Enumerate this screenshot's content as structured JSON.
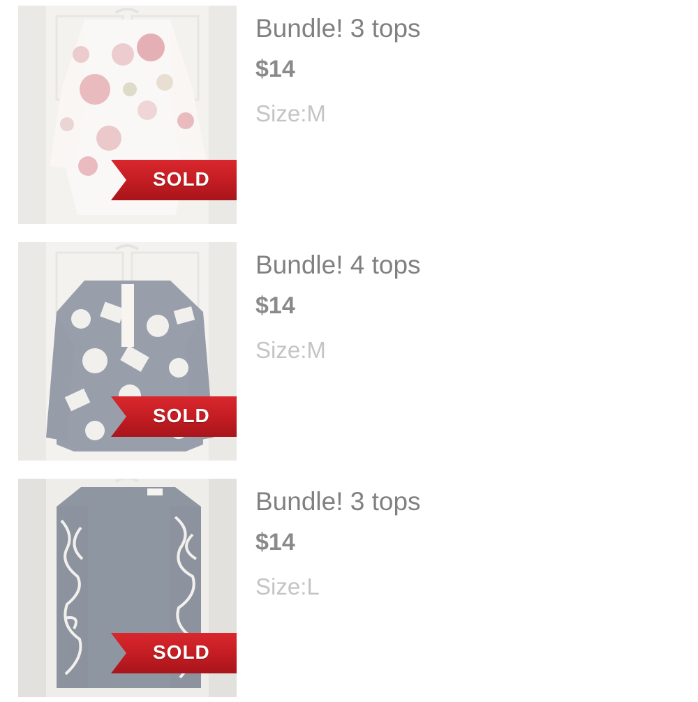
{
  "listings": [
    {
      "title": "Bundle! 3 tops",
      "price": "$14",
      "size": "Size:M",
      "badge": "SOLD",
      "image": "floral-white-blouse"
    },
    {
      "title": "Bundle! 4 tops",
      "price": "$14",
      "size": "Size:M",
      "badge": "SOLD",
      "image": "navy-white-print-blouse"
    },
    {
      "title": "Bundle! 3 tops",
      "price": "$14",
      "size": "Size:L",
      "badge": "SOLD",
      "image": "navy-blouse-white-squiggle-sleeves"
    }
  ],
  "colors": {
    "badge": "#c21c22",
    "title": "#808080",
    "price": "#8a8a8a",
    "size": "#c4c4c4"
  }
}
